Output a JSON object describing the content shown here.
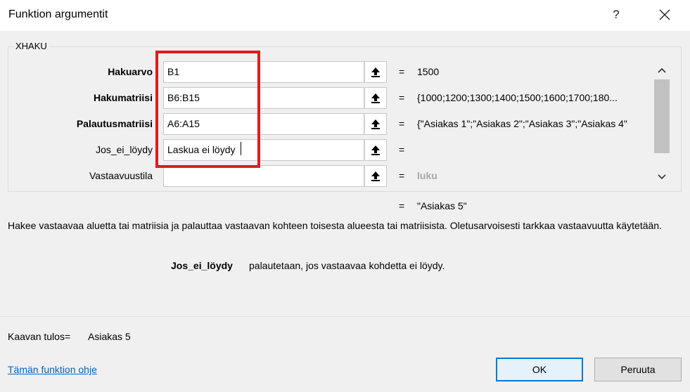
{
  "dialog": {
    "title": "Funktion argumentit",
    "help_glyph": "?",
    "close_icon": "close-icon"
  },
  "group": {
    "label": "XHAKU"
  },
  "arguments": [
    {
      "label": "Hakuarvo",
      "bold": true,
      "input": "B1",
      "equals": "=",
      "value": "1500"
    },
    {
      "label": "Hakumatriisi",
      "bold": true,
      "input": "B6:B15",
      "equals": "=",
      "value": "{1000;1200;1300;1400;1500;1600;1700;180..."
    },
    {
      "label": "Palautusmatriisi",
      "bold": true,
      "input": "A6:A15",
      "equals": "=",
      "value": "{\"Asiakas 1\";\"Asiakas 2\";\"Asiakas 3\";\"Asiakas 4\""
    },
    {
      "label": "Jos_ei_löydy",
      "bold": false,
      "input": "Laskua ei löydy",
      "equals": "=",
      "value": ""
    },
    {
      "label": "Vastaavuustila",
      "bold": false,
      "input": "",
      "equals": "=",
      "value": "luku"
    }
  ],
  "result": {
    "equals": "=",
    "value": "\"Asiakas 5\""
  },
  "description": "Hakee vastaavaa aluetta tai matriisia ja palauttaa vastaavan kohteen toisesta alueesta tai matriisista. Oletusarvoisesti tarkkaa vastaavuutta käytetään.",
  "arg_help": {
    "name": "Jos_ei_löydy",
    "text": "palautetaan, jos vastaavaa kohdetta ei löydy."
  },
  "formula_result": {
    "label": "Kaavan tulos=",
    "value": "Asiakas 5"
  },
  "footer": {
    "help_link": "Tämän funktion ohje",
    "ok_label": "OK",
    "cancel_label": "Peruuta"
  },
  "colors": {
    "highlight": "#e01c1c",
    "link": "#0563c1",
    "ok_border": "#0078d7"
  }
}
